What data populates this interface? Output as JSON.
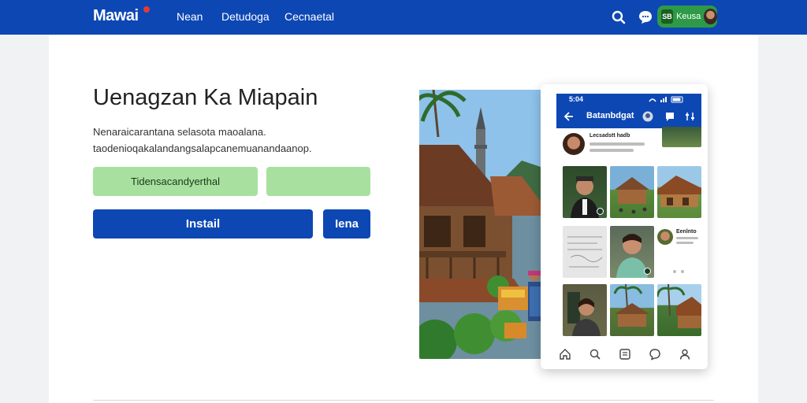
{
  "app": {
    "logo_text": "Mawai"
  },
  "nav": {
    "links": [
      {
        "label": "Nean"
      },
      {
        "label": "Detudoga"
      },
      {
        "label": "Cecnaetal"
      }
    ]
  },
  "topbar": {
    "search_icon": "search-icon",
    "chat_icon": "chat-icon",
    "account": {
      "badge": "SB",
      "label": "Keusa"
    }
  },
  "hero": {
    "title": "Uenagzan Ka Miapain",
    "line1": "Nenaraicarantana selasota maoalana.",
    "line2": "taodenioqakalandangsalapcanemuanandaanop.",
    "green_button_1": "Tidensacandyerthal",
    "green_button_2": "",
    "install_button": "Instail",
    "secondary_button": "Iena"
  },
  "phone": {
    "status_time": "5:04",
    "title": "Batanbdgat",
    "post_title": "Lecsadstt hadb",
    "post2_title": "Eenlnto"
  },
  "colors": {
    "brand_blue": "#0d47b4",
    "accent_green": "#a8e0a0",
    "account_green": "#2e9a47"
  }
}
